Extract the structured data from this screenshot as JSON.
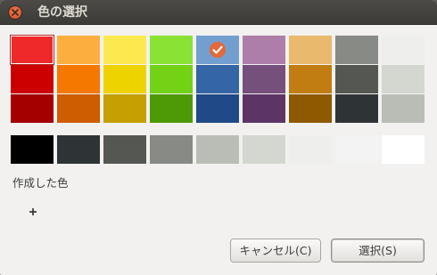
{
  "window": {
    "title": "色の選択"
  },
  "palette": {
    "rows": [
      [
        {
          "name": "red-light",
          "color": "#ef2929",
          "selected": true
        },
        {
          "name": "orange-light",
          "color": "#fcaf3e"
        },
        {
          "name": "yellow-light",
          "color": "#fce94f"
        },
        {
          "name": "green-light",
          "color": "#8ae234"
        },
        {
          "name": "blue-light",
          "color": "#729fcf",
          "checked": true
        },
        {
          "name": "purple-light",
          "color": "#ad7fa8"
        },
        {
          "name": "brown-light",
          "color": "#e9b96e"
        },
        {
          "name": "dark-gray-light",
          "color": "#888a85"
        },
        {
          "name": "light-gray-light",
          "color": "#eeeeec"
        }
      ],
      [
        {
          "name": "red",
          "color": "#cc0000"
        },
        {
          "name": "orange",
          "color": "#f57900"
        },
        {
          "name": "yellow",
          "color": "#edd400"
        },
        {
          "name": "green",
          "color": "#73d216"
        },
        {
          "name": "blue",
          "color": "#3465a4"
        },
        {
          "name": "purple",
          "color": "#75507b"
        },
        {
          "name": "brown",
          "color": "#c17d11"
        },
        {
          "name": "dark-gray",
          "color": "#555753"
        },
        {
          "name": "light-gray",
          "color": "#d3d7cf"
        }
      ],
      [
        {
          "name": "red-dark",
          "color": "#a40000"
        },
        {
          "name": "orange-dark",
          "color": "#ce5c00"
        },
        {
          "name": "yellow-dark",
          "color": "#c4a000"
        },
        {
          "name": "green-dark",
          "color": "#4e9a06"
        },
        {
          "name": "blue-dark",
          "color": "#204a87"
        },
        {
          "name": "purple-dark",
          "color": "#5c3566"
        },
        {
          "name": "brown-dark",
          "color": "#8f5902"
        },
        {
          "name": "dark-gray-dark",
          "color": "#2e3436"
        },
        {
          "name": "light-gray-dark",
          "color": "#babdb6"
        }
      ]
    ],
    "grays": [
      {
        "name": "black",
        "color": "#000000"
      },
      {
        "name": "very-dark-gray",
        "color": "#2e3436"
      },
      {
        "name": "darker-gray",
        "color": "#555753"
      },
      {
        "name": "dark-gray",
        "color": "#888a85"
      },
      {
        "name": "gray",
        "color": "#babdb6"
      },
      {
        "name": "light-gray",
        "color": "#d3d7cf"
      },
      {
        "name": "lighter-gray",
        "color": "#eeeeec"
      },
      {
        "name": "very-light-gray",
        "color": "#f3f3f3"
      },
      {
        "name": "white",
        "color": "#ffffff"
      }
    ]
  },
  "custom": {
    "label": "作成した色",
    "add_symbol": "+"
  },
  "buttons": {
    "cancel_label": "キャンセル(C)",
    "select_label": "選択(S)"
  }
}
